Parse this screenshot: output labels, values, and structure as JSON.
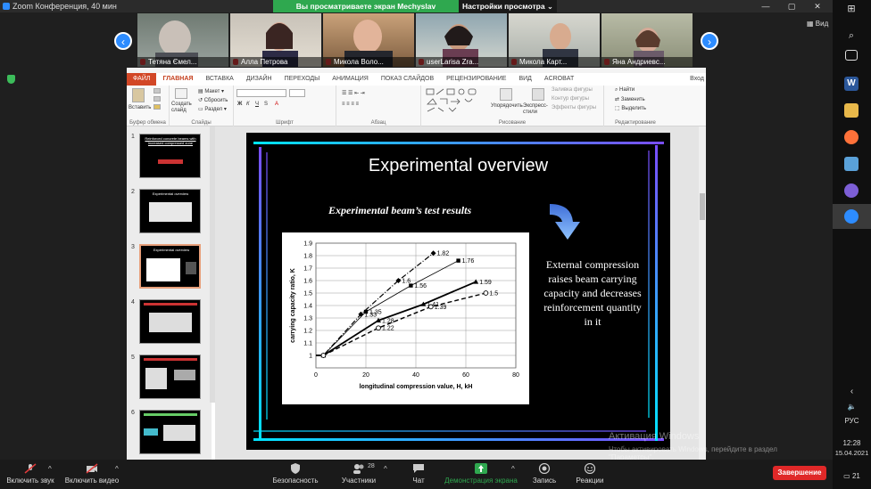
{
  "zoom": {
    "window_title": "Zoom Конференция, 40 мин",
    "share_banner": "Вы просматриваете экран Mechyslav Chekanovych",
    "view_settings": "Настройки просмотра ⌄",
    "view_button": "Вид",
    "participants": [
      {
        "name": "Тетяна Ємел..."
      },
      {
        "name": "Алла Петрова"
      },
      {
        "name": "Микола Воло..."
      },
      {
        "name": "userLarisa Zra..."
      },
      {
        "name": "Микола Карт..."
      },
      {
        "name": "Яна Андриевс..."
      }
    ],
    "toolbar": {
      "mute": "Включить звук",
      "video": "Включить видео",
      "security": "Безопасность",
      "participants": "Участники",
      "participants_count": "28",
      "chat": "Чат",
      "share": "Демонстрация экрана",
      "record": "Запись",
      "reactions": "Реакции",
      "end": "Завершение"
    }
  },
  "powerpoint": {
    "tabs": [
      "ФАЙЛ",
      "ГЛАВНАЯ",
      "ВСТАВКА",
      "ДИЗАЙН",
      "ПЕРЕХОДЫ",
      "АНИМАЦИЯ",
      "ПОКАЗ СЛАЙДОВ",
      "РЕЦЕНЗИРОВАНИЕ",
      "ВИД",
      "ACROBAT"
    ],
    "login": "Вход",
    "ribbon": {
      "paste": "Вставить",
      "clipboard_group": "Буфер обмена",
      "create_slide": "Создать слайд",
      "layout": "Макет",
      "reset": "Сбросить",
      "section": "Раздел",
      "slides_group": "Слайды",
      "font_group": "Шрифт",
      "paragraph_group": "Абзац",
      "arrange": "Упорядочить",
      "quick_styles": "Экспресс-стили",
      "shape_fill": "Заливка фигуры",
      "shape_outline": "Контур фигуры",
      "shape_effects": "Эффекты фигуры",
      "drawing_group": "Рисование",
      "find": "Найти",
      "replace": "Заменить",
      "select": "Выделить",
      "editing_group": "Редактирование"
    },
    "thumbnails": [
      {
        "num": "1",
        "text": "Reinforced concrete beams with increased compressed zone"
      },
      {
        "num": "2",
        "text": "Experimental overview"
      },
      {
        "num": "3",
        "text": "Experimental overview"
      },
      {
        "num": "4",
        "text": ""
      },
      {
        "num": "5",
        "text": ""
      },
      {
        "num": "6",
        "text": ""
      }
    ]
  },
  "slide": {
    "title": "Experimental overview",
    "subtitle": "Experimental beam’s test results",
    "side_text": "External compression raises beam carrying capacity and decreases reinforcement quantity in it"
  },
  "chart_data": {
    "type": "line",
    "xlabel": "longitudinal compression value, H, kH",
    "ylabel": "carrying capacity ratio, K",
    "xlim": [
      0,
      80
    ],
    "ylim": [
      0.9,
      1.9
    ],
    "x_ticks": [
      "0",
      "20",
      "40",
      "60",
      "80"
    ],
    "y_ticks": [
      "1",
      "1.1",
      "1.2",
      "1.3",
      "1.4",
      "1.5",
      "1.6",
      "1.7",
      "1.8",
      "1.9"
    ],
    "grid": true,
    "series": [
      {
        "style": "dash-dot",
        "marker": "diamond",
        "points": [
          [
            0,
            1
          ],
          [
            3,
            1
          ],
          [
            18,
            1.33
          ],
          [
            33,
            1.6
          ],
          [
            47,
            1.82
          ]
        ],
        "labels": [
          "",
          "",
          "1.33",
          "1.6",
          "1.82"
        ]
      },
      {
        "style": "solid-thin",
        "marker": "square",
        "points": [
          [
            0,
            1
          ],
          [
            3,
            1
          ],
          [
            20,
            1.35
          ],
          [
            38,
            1.56
          ],
          [
            57,
            1.76
          ]
        ],
        "labels": [
          "",
          "",
          "1.35",
          "1.56",
          "1.76"
        ]
      },
      {
        "style": "solid-thick",
        "marker": "triangle",
        "points": [
          [
            0,
            1
          ],
          [
            3,
            1
          ],
          [
            25,
            1.28
          ],
          [
            43,
            1.41
          ],
          [
            64,
            1.59
          ]
        ],
        "labels": [
          "",
          "",
          "1.28",
          "1.41",
          "1.59"
        ]
      },
      {
        "style": "dashed",
        "marker": "circle",
        "points": [
          [
            0,
            1
          ],
          [
            3,
            1
          ],
          [
            25,
            1.22
          ],
          [
            46,
            1.39
          ],
          [
            68,
            1.5
          ]
        ],
        "labels": [
          "",
          "",
          "1.22",
          "1.39",
          "1.5"
        ]
      }
    ]
  },
  "taskbar": {
    "lang": "РУС",
    "time": "12:28",
    "date": "15.04.2021",
    "notif_count": "21"
  },
  "watermark": {
    "line1": "Активация Windows",
    "line2": "Чтобы активировать Windows, перейдите в раздел \"Параметры\"."
  }
}
